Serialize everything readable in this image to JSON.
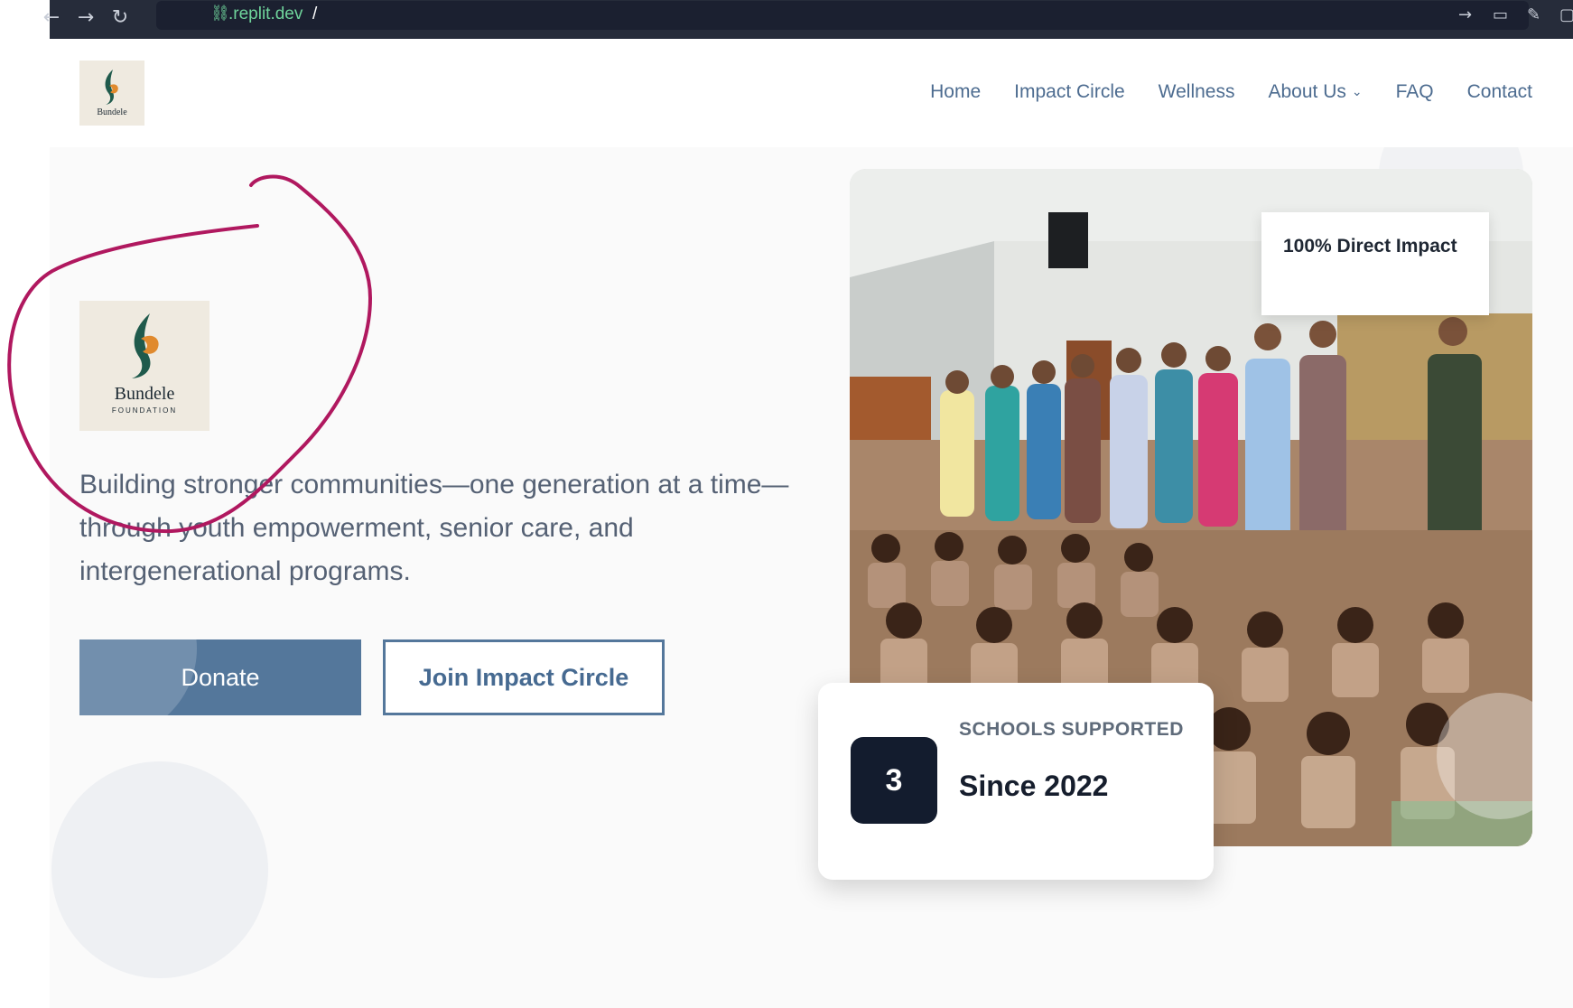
{
  "browser": {
    "url": ".replit.dev",
    "url_cursor": "/",
    "icons": [
      "back-arrow-icon",
      "forward-arrow-icon",
      "reload-icon",
      "link-icon",
      "forward-icon",
      "monitor-icon",
      "wrench-icon"
    ]
  },
  "header": {
    "nav": [
      {
        "label": "Home"
      },
      {
        "label": "Impact Circle"
      },
      {
        "label": "Wellness"
      },
      {
        "label": "About Us"
      },
      {
        "label": "FAQ"
      },
      {
        "label": "Contact"
      }
    ]
  },
  "logo": {
    "name": "Bundele",
    "subtitle": "FOUNDATION"
  },
  "hero": {
    "tagline": "Building stronger communities—one generation at a time—through youth empowerment, senior care, and intergenerational programs.",
    "donate_label": "Donate",
    "join_label": "Join Impact Circle",
    "impact_badge": "100% Direct Impact",
    "stats": {
      "number": "3",
      "label": "SCHOOLS SUPPORTED",
      "since": "Since 2022"
    }
  },
  "colors": {
    "accent": "#54779b",
    "nav_text": "#4d6c90",
    "annotation": "#b0185f",
    "dark_badge": "#131c2e"
  }
}
